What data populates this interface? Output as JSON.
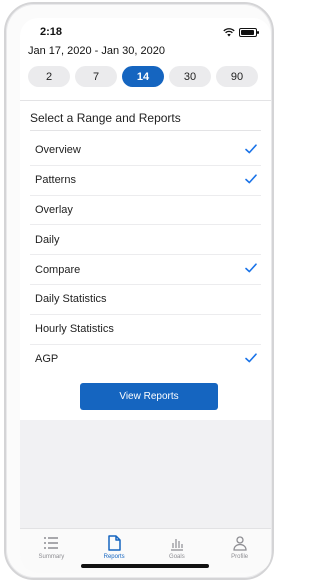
{
  "status_bar": {
    "time": "2:18"
  },
  "date_range": "Jan 17, 2020 - Jan 30, 2020",
  "day_options": [
    {
      "label": "2",
      "selected": false
    },
    {
      "label": "7",
      "selected": false
    },
    {
      "label": "14",
      "selected": true
    },
    {
      "label": "30",
      "selected": false
    },
    {
      "label": "90",
      "selected": false
    }
  ],
  "section_title": "Select a Range and Reports",
  "reports": [
    {
      "label": "Overview",
      "checked": true
    },
    {
      "label": "Patterns",
      "checked": true
    },
    {
      "label": "Overlay",
      "checked": false
    },
    {
      "label": "Daily",
      "checked": false
    },
    {
      "label": "Compare",
      "checked": true
    },
    {
      "label": "Daily Statistics",
      "checked": false
    },
    {
      "label": "Hourly Statistics",
      "checked": false
    },
    {
      "label": "AGP",
      "checked": true
    }
  ],
  "view_button_label": "View Reports",
  "tabs": [
    {
      "label": "Summary",
      "icon": "list-icon",
      "active": false
    },
    {
      "label": "Reports",
      "icon": "document-icon",
      "active": true
    },
    {
      "label": "Goals",
      "icon": "bar-chart-icon",
      "active": false
    },
    {
      "label": "Profile",
      "icon": "person-icon",
      "active": false
    }
  ],
  "colors": {
    "accent": "#1565c0",
    "check": "#1a73e8",
    "pill": "#ebebed"
  }
}
